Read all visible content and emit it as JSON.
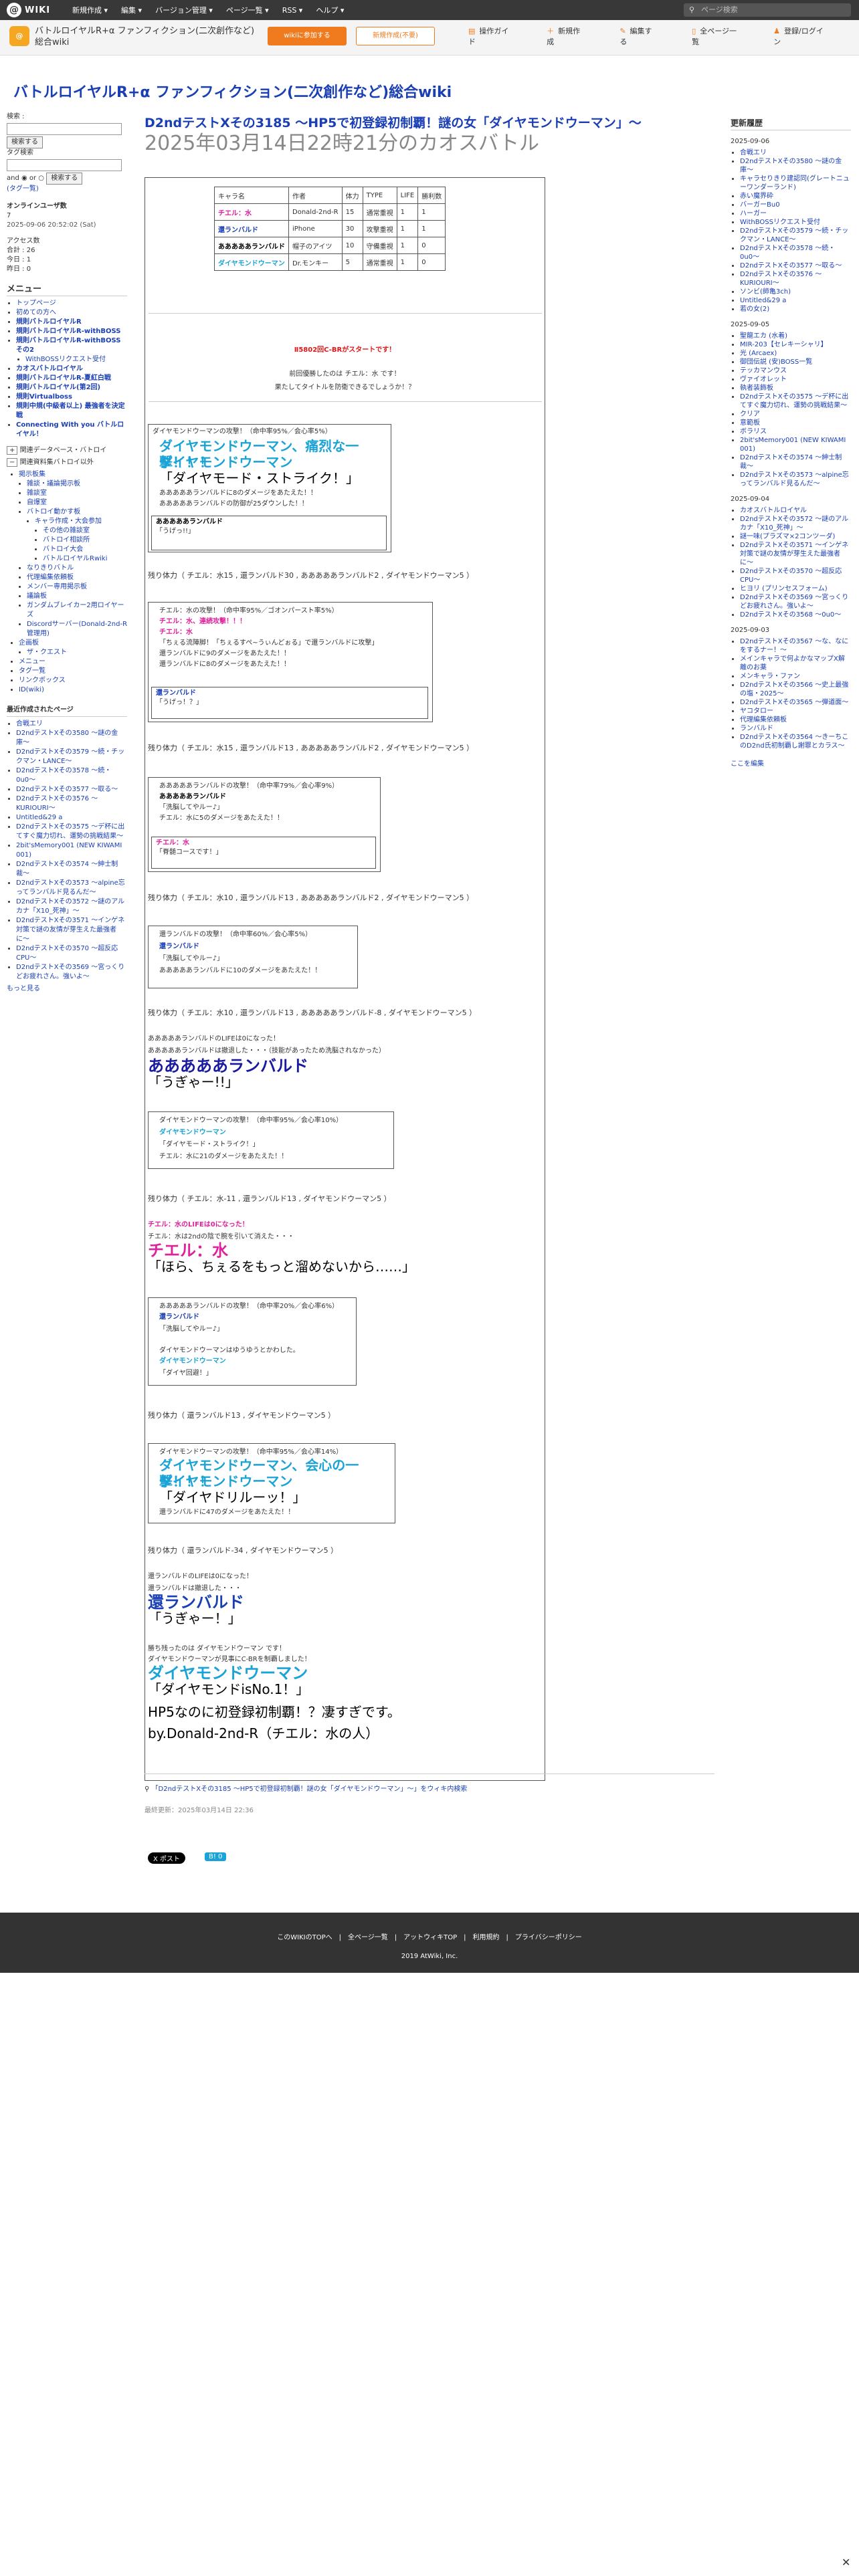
{
  "topbar": {
    "logo_glyph": "@",
    "logo_text": "WIKI",
    "menu": [
      "新規作成 ▾",
      "編集 ▾",
      "バージョン管理 ▾",
      "ページ一覧 ▾",
      "RSS ▾",
      "ヘルプ ▾"
    ],
    "search_placeholder": "ページ検索"
  },
  "wikibar": {
    "title": "バトルロイヤルR+α ファンフィクション(二次創作など)総合wiki",
    "join_label": "wikiに参加する",
    "edit_label": "新規作成(不要)",
    "tools": [
      "操作ガイド",
      "新規作成",
      "編集する",
      "全ページ一覧",
      "登録/ログイン"
    ]
  },
  "site_title": "バトルロイヤルR+α ファンフィクション(二次創作など)総合wiki",
  "left": {
    "search_label": "検索 :",
    "search_btn": "検索する",
    "tag_label": "タグ検索",
    "and_or": "and ◉ or ○",
    "search_btn2": "検索する",
    "tag_list": "(タグ一覧)",
    "online_title": "オンラインユーザ数",
    "online_count": "7",
    "online_date": "2025-09-06 20:52:02 (Sat)",
    "access_title": "アクセス数",
    "access": [
      "合計 : 26",
      "今日 : 1",
      "昨日 : 0"
    ],
    "menu_title": "メニュー",
    "menu_items": [
      "トップページ",
      "初めての方へ",
      "規則バトルロイヤルR",
      "規則バトルロイヤルR-withBOSS",
      "規則バトルロイヤルR-withBOSS その2",
      "WithBOSSリクエスト受付",
      "カオスバトルロイヤル",
      "規則バトルロイヤルR-夏紅白戦",
      "規則バトルロイヤル(第2回)",
      "規則Virtualboss",
      "規則中規(中級者以上) 最強者を決定戦",
      "Connecting With you バトルロイヤル！"
    ],
    "sub_label1": "関連データベース・バトロイ",
    "sub_label2": "関連資料集バトロイ以外",
    "tree_items": [
      "掲示板集",
      "雑談・議論掲示板",
      "雑談室",
      "自爆室",
      "バトロイ動かす板",
      "キャラ作成・大会参加",
      "その他の雑談室",
      "バトロイ相談所",
      "バトロイ大会",
      "バトルロイヤルRwiki",
      "なりきりバトル",
      "代理編集依頼板",
      "メンバー専用掲示板",
      "議論板",
      "ガンダムブレイカー2用ロイヤーズ",
      "Discordサーバー(Donald-2nd-R管理用)",
      "企画板",
      "ザ・クエスト",
      "メニュー",
      "タグ一覧",
      "リンクボックス",
      "ID(wiki)"
    ],
    "recent_title": "最近作成されたページ",
    "recent_items": [
      "合戦エリ",
      "D2ndテストXその3580 〜謎の金庫〜",
      "D2ndテストXその3579 〜続・チックマン・LANCE〜",
      "D2ndテストXその3578 〜続・0u0〜",
      "D2ndテストXその3577 〜取る〜",
      "D2ndテストXその3576 〜KURIOURI〜",
      "Untitled&29 a",
      "D2ndテストXその3575 〜デ杯に出てすぐ魔力切れ、運勢の挑戦結果〜",
      "2bit'sMemory001 (NEW KIWAMI 001)",
      "D2ndテストXその3574 〜紳士制裁〜",
      "D2ndテストXその3573 〜alpine忘ってランバルド見るんだ〜",
      "D2ndテストXその3572 〜謎のアルカナ「X10_死神」〜",
      "D2ndテストXその3571 〜インゲネ対策で謎の友情が芽生えた最強者に〜",
      "D2ndテストXその3570 〜超反応CPU〜",
      "D2ndテストXその3569 〜宮っくりどお疲れさん。強いよ〜"
    ],
    "more": "もっと見る"
  },
  "right": {
    "title": "更新履歴",
    "groups": [
      {
        "date": "2025-09-06",
        "items": [
          "合戦エリ",
          "D2ndテストXその3580 〜謎の金庫〜",
          "キャラセりきり建認同(グレートニューワンダーランド)",
          "赤い魔界砕",
          "バーガーBu0",
          "ハーガー",
          "WithBOSSリクエスト受付",
          "D2ndテストXその3579 〜続・チックマン・LANCE〜",
          "D2ndテストXその3578 〜続・0u0〜",
          "D2ndテストXその3577 〜取る〜",
          "D2ndテストXその3576 〜KURIOURI〜",
          "ソンビ(師亀3ch)",
          "Untitled&29 a",
          "若の女(2)"
        ]
      },
      {
        "date": "2025-09-05",
        "items": [
          "聖龍エカ (水着)",
          "MIR-203【セレキーシャリ】",
          "光 (Arcaex)",
          "御団伝説 (安)BOSS一覧",
          "テッカマンウス",
          "ヴァイオレット",
          "執者装飾板",
          "D2ndテストXその3575 〜デ杯に出てすぐ魔力切れ、運勢の挑戦結果〜",
          "クリア",
          "意範板",
          "ボラリス",
          "2bit'sMemory001 (NEW KIWAMI 001)",
          "D2ndテストXその3574 〜紳士制裁〜",
          "D2ndテストXその3573 〜alpine忘ってランバルド見るんだ〜"
        ]
      },
      {
        "date": "2025-09-04",
        "items": [
          "カオスバトルロイヤル",
          "D2ndテストXその3572 〜謎のアルカナ「X10_死神」〜",
          "謎一味(プラズマ×2コンツーダ)",
          "D2ndテストXその3571 〜インゲネ対策で謎の友情が芽生えた最強者に〜",
          "D2ndテストXその3570 〜超反応CPU〜",
          "ヒヨリ (プリンセスフォーム)",
          "D2ndテストXその3569 〜宮っくりどお疲れさん。強いよ〜",
          "D2ndテストXその3568 〜0u0〜"
        ]
      },
      {
        "date": "2025-09-03",
        "items": [
          "D2ndテストXその3567 〜な、なにをするナー！〜",
          "メインキャラで何よかなマップX解離のお薬",
          "メンキャラ・ファン",
          "D2ndテストXその3566 〜史上最強の塩・2025〜",
          "D2ndテストXその3565 〜弾道面〜",
          "ヤコタロー",
          "代理編集依頼板",
          "ランバルド",
          "D2ndテストXその3564 〜きーちこのD2nd氏初制覇し謝罪とカラス〜"
        ]
      }
    ],
    "edit_link": "ここを編集"
  },
  "main": {
    "title": "D2ndテストXその3185 〜HP5で初登録初制覇！謎の女「ダイヤモンドウーマン」〜",
    "subtitle": "2025年03月14日22時21分のカオスバトル",
    "table": {
      "headers": [
        "キャラ名",
        "作者",
        "体力",
        "TYPE",
        "LIFE",
        "勝利数"
      ],
      "rows": [
        [
          "チエル：水",
          "Donald-2nd-R",
          "15",
          "通常重視",
          "1",
          "1"
        ],
        [
          "還ランバルド",
          "iPhone",
          "30",
          "攻撃重視",
          "1",
          "1"
        ],
        [
          "あああああランバルド",
          "帽子のアイツ",
          "10",
          "守備重視",
          "1",
          "0"
        ],
        [
          "ダイヤモンドウーマン",
          "Dr.モンキー",
          "5",
          "通常重視",
          "1",
          "0"
        ]
      ]
    },
    "start_line": "Ⅱ5802回C-BRがスタートです！",
    "prev_winner": "前回優勝したのは チエル：水 です！",
    "ask_line": "果たしてタイトルを防衛できるでしょうか！？",
    "battles": [
      {
        "lines": [
          "ダイヤモンドウーマンの攻撃！（命中率95%／会心率5%）",
          "ダイヤモンドウーマン、痛烈な一撃！！！",
          "ダイヤモンドウーマン",
          "「ダイヤモード・ストライク！」",
          "あああああランバルドに8のダメージをあたえた！！",
          "あああああランバルドの防御が25ダウンした！！"
        ],
        "inner": [
          "あああああランバルド",
          "「うげっ!!」"
        ]
      },
      {
        "lines": [
          "チエル：水の攻撃！（命中率95%／ゴオンパースト率5%）",
          "チエル：水、連続攻撃！！！",
          "チエル：水",
          "「ちぇる流陣脚！「ちぇるすぺ~うぃんどぉる」で還ランバルドに攻撃」",
          "還ランバルドに9のダメージをあたえた！！",
          "還ランバルドに8のダメージをあたえた！！"
        ],
        "inner": [
          "還ランバルド",
          "「うげっ！？」"
        ]
      },
      {
        "lines": [
          "あああああランバルドの攻撃！（命中率79%／会心率9%）",
          "あああああランバルド",
          "「洗脳してやルー♪」",
          "チエル：水に5のダメージをあたえた！！"
        ],
        "inner": [
          "チエル：水",
          "「脊髄コースです！」"
        ]
      },
      {
        "lines": [
          "還ランバルドの攻撃！（命中率60%／会心率5%）",
          "還ランバルド",
          "「洗脳してやルー♪」",
          "あああああランバルドに10のダメージをあたえた！！"
        ],
        "inner": []
      },
      {
        "lines": [
          "ダイヤモンドウーマンの攻撃！（命中率95%／会心率10%）",
          "ダイヤモンドウーマン",
          "「ダイヤモード・ストライク！」",
          "チエル：水に21のダメージをあたえた！！"
        ],
        "inner": []
      },
      {
        "lines": [
          "あああああランバルドの攻撃！（命中率20%／会心率6%）",
          "還ランバルド",
          "「洗脳してやルー♪」",
          "ダイヤモンドウーマンはゆうゆうとかわした。",
          "ダイヤモンドウーマン",
          "「ダイヤ回避！」"
        ],
        "inner": []
      },
      {
        "lines": [
          "ダイヤモンドウーマンの攻撃！（命中率95%／会心率14%）",
          "ダイヤモンドウーマン、会心の一撃！！！",
          "ダイヤモンドウーマン",
          "「ダイヤドリルーッ！」",
          "還ランバルドに47のダメージをあたえた！！"
        ],
        "inner": []
      }
    ],
    "remains": [
      "残り体力（ チエル：水15 , 還ランバルド30 , あああああランバルド2 , ダイヤモンドウーマン5 ）",
      "残り体力（ チエル：水15 , 還ランバルド13 , あああああランバルド2 , ダイヤモンドウーマン5 ）",
      "残り体力（ チエル：水10 , 還ランバルド13 , あああああランバルド2 , ダイヤモンドウーマン5 ）",
      "残り体力（ チエル：水10 , 還ランバルド13 , あああああランバルド-8 , ダイヤモンドウーマン5 ）",
      "残り体力（ チエル：水-11 , 還ランバルド13 , ダイヤモンドウーマン5 ）",
      "残り体力（ 還ランバルド13 , ダイヤモンドウーマン5 ）",
      "残り体力（ 還ランバルド-34 , ダイヤモンドウーマン5 ）"
    ],
    "ko1": {
      "a": "あああああランバルドのLIFEは0になった！",
      "b": "あああああランバルドは撤退した・・・（技能があったため洗脳されなかった）",
      "name": "あああああランバルド",
      "quote": "「うぎゃー!!」"
    },
    "ko2": {
      "a": "チエル：水のLIFEは0になった！",
      "b": "チエル：水は2ndの陰で腕を引いて消えた・・・",
      "name": "チエル：水",
      "quote": "「ほら、ちぇるをもっと溜めないから……」"
    },
    "ko3": {
      "a": "還ランバルドのLIFEは0になった！",
      "b": "還ランバルドは撤退した・・・",
      "name": "還ランバルド",
      "quote": "「うぎゃー！」"
    },
    "end1": "勝ち残ったのは ダイヤモンドウーマン です！",
    "end2": "ダイヤモンドウーマンが見事にC-BRを制覇しました！",
    "winner_name": "ダイヤモンドウーマン",
    "winner_quote": "「ダイヤモンドisNo.1！」",
    "closing1": "HP5なのに初登録初制覇！？凄すぎです。",
    "closing2": "by.Donald-2nd-R（チエル：水の人）",
    "share_link": "「D2ndテストXその3185 〜HP5で初登録初制覇！謎の女「ダイヤモンドウーマン」〜」をウィキ内検索",
    "updated": "最終更新：2025年03月14日 22:36",
    "post_btn": "X ポスト",
    "share_btn": "B! 0"
  },
  "footer": {
    "links": "このWIKIのTOPへ　|　全ページ一覧　|　アットウィキTOP　|　利用規約　|　プライバシーポリシー",
    "copy": "2019 AtWiki, Inc."
  },
  "colors": {
    "accent": "#f07b1e",
    "link": "#1a3fb5",
    "pink": "#e0219c",
    "cyan": "#1aa3d6",
    "topbar": "#383838"
  }
}
